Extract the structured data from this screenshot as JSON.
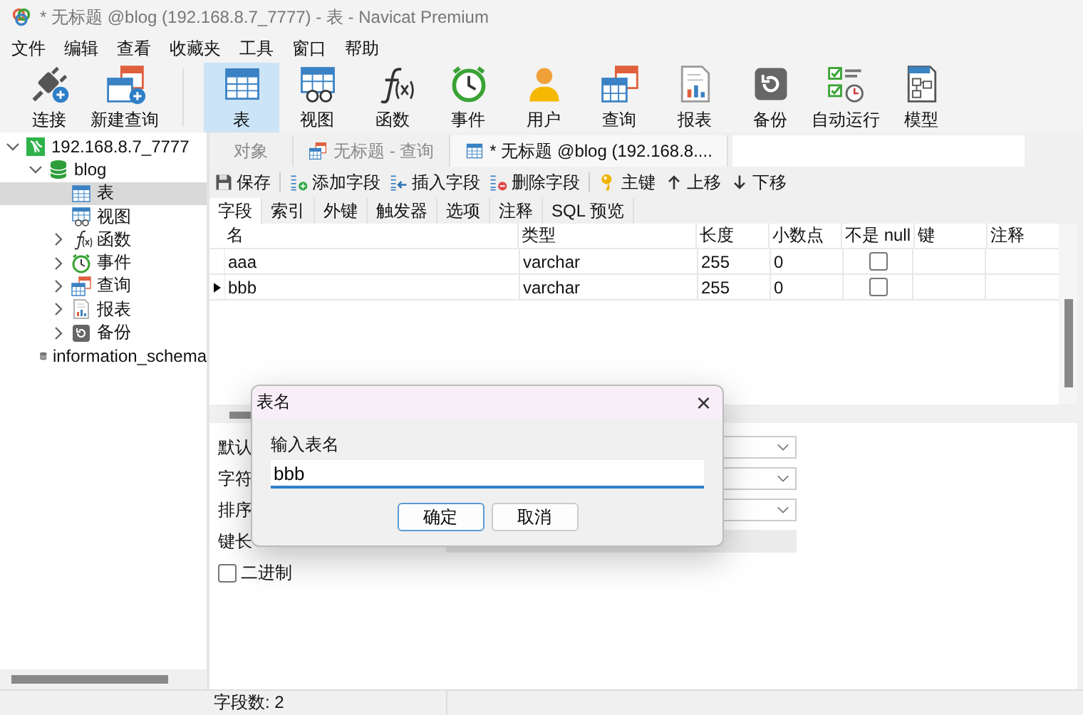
{
  "window": {
    "title": "* 无标题 @blog (192.168.8.7_7777) - 表 - Navicat Premium"
  },
  "menu": [
    "文件",
    "编辑",
    "查看",
    "收藏夹",
    "工具",
    "窗口",
    "帮助"
  ],
  "toolbar": {
    "left": [
      {
        "label": "连接",
        "kind": "connect",
        "selected": false
      },
      {
        "label": "新建查询",
        "kind": "new-query",
        "selected": false
      }
    ],
    "right": [
      {
        "label": "表",
        "kind": "table",
        "selected": true
      },
      {
        "label": "视图",
        "kind": "view",
        "selected": false
      },
      {
        "label": "函数",
        "kind": "function",
        "selected": false
      },
      {
        "label": "事件",
        "kind": "event",
        "selected": false
      },
      {
        "label": "用户",
        "kind": "user",
        "selected": false
      },
      {
        "label": "查询",
        "kind": "query",
        "selected": false
      },
      {
        "label": "报表",
        "kind": "report",
        "selected": false
      },
      {
        "label": "备份",
        "kind": "backup",
        "selected": false
      },
      {
        "label": "自动运行",
        "kind": "automation",
        "selected": false
      },
      {
        "label": "模型",
        "kind": "model",
        "selected": false
      }
    ]
  },
  "sidebar": {
    "tree": [
      {
        "label": "192.168.8.7_7777",
        "kind": "server",
        "expanded": true,
        "selected": false,
        "children": [
          {
            "label": "blog",
            "kind": "database-open",
            "expanded": true,
            "selected": false,
            "children": [
              {
                "label": "表",
                "kind": "table",
                "selected": true
              },
              {
                "label": "视图",
                "kind": "view",
                "selected": false
              },
              {
                "label": "函数",
                "kind": "function",
                "expanded": false,
                "selected": false
              },
              {
                "label": "事件",
                "kind": "event",
                "expanded": false,
                "selected": false
              },
              {
                "label": "查询",
                "kind": "query",
                "expanded": false,
                "selected": false
              },
              {
                "label": "报表",
                "kind": "report",
                "expanded": false,
                "selected": false
              },
              {
                "label": "备份",
                "kind": "backup",
                "expanded": false,
                "selected": false
              }
            ]
          },
          {
            "label": "information_schema",
            "kind": "database",
            "selected": false
          }
        ]
      }
    ]
  },
  "tabs": [
    {
      "label": "对象",
      "kind": "plain",
      "selected": false
    },
    {
      "label": "无标题 - 查询",
      "kind": "query",
      "selected": false
    },
    {
      "label": "* 无标题 @blog (192.168.8....",
      "kind": "table",
      "selected": true
    }
  ],
  "field_toolbar": [
    {
      "label": "保存",
      "kind": "save"
    },
    {
      "label": "添加字段",
      "kind": "add-field"
    },
    {
      "label": "插入字段",
      "kind": "insert-field"
    },
    {
      "label": "删除字段",
      "kind": "delete-field"
    },
    {
      "label": "主键",
      "kind": "key"
    },
    {
      "label": "上移",
      "kind": "up"
    },
    {
      "label": "下移",
      "kind": "down"
    }
  ],
  "sub_tabs": [
    {
      "label": "字段",
      "selected": true
    },
    {
      "label": "索引",
      "selected": false
    },
    {
      "label": "外键",
      "selected": false
    },
    {
      "label": "触发器",
      "selected": false
    },
    {
      "label": "选项",
      "selected": false
    },
    {
      "label": "注释",
      "selected": false
    },
    {
      "label": "SQL 预览",
      "selected": false
    }
  ],
  "table": {
    "columns": [
      "名",
      "类型",
      "长度",
      "小数点",
      "不是 null",
      "键",
      "注释"
    ],
    "rows": [
      {
        "current": false,
        "name": "aaa",
        "type": "varchar",
        "length": "255",
        "decimals": "0",
        "not_null": false
      },
      {
        "current": true,
        "name": "bbb",
        "type": "varchar",
        "length": "255",
        "decimals": "0",
        "not_null": false
      }
    ]
  },
  "properties": {
    "labels": [
      "默认",
      "字符",
      "排序",
      "键长"
    ],
    "binary": {
      "label": "二进制",
      "checked": false
    }
  },
  "status_bar": {
    "field_count": "字段数: 2"
  },
  "dialog": {
    "title": "表名",
    "close": "×",
    "label": "输入表名",
    "value": "bbb",
    "buttons": [
      {
        "label": "确定",
        "default": true
      },
      {
        "label": "取消",
        "default": false
      }
    ]
  }
}
